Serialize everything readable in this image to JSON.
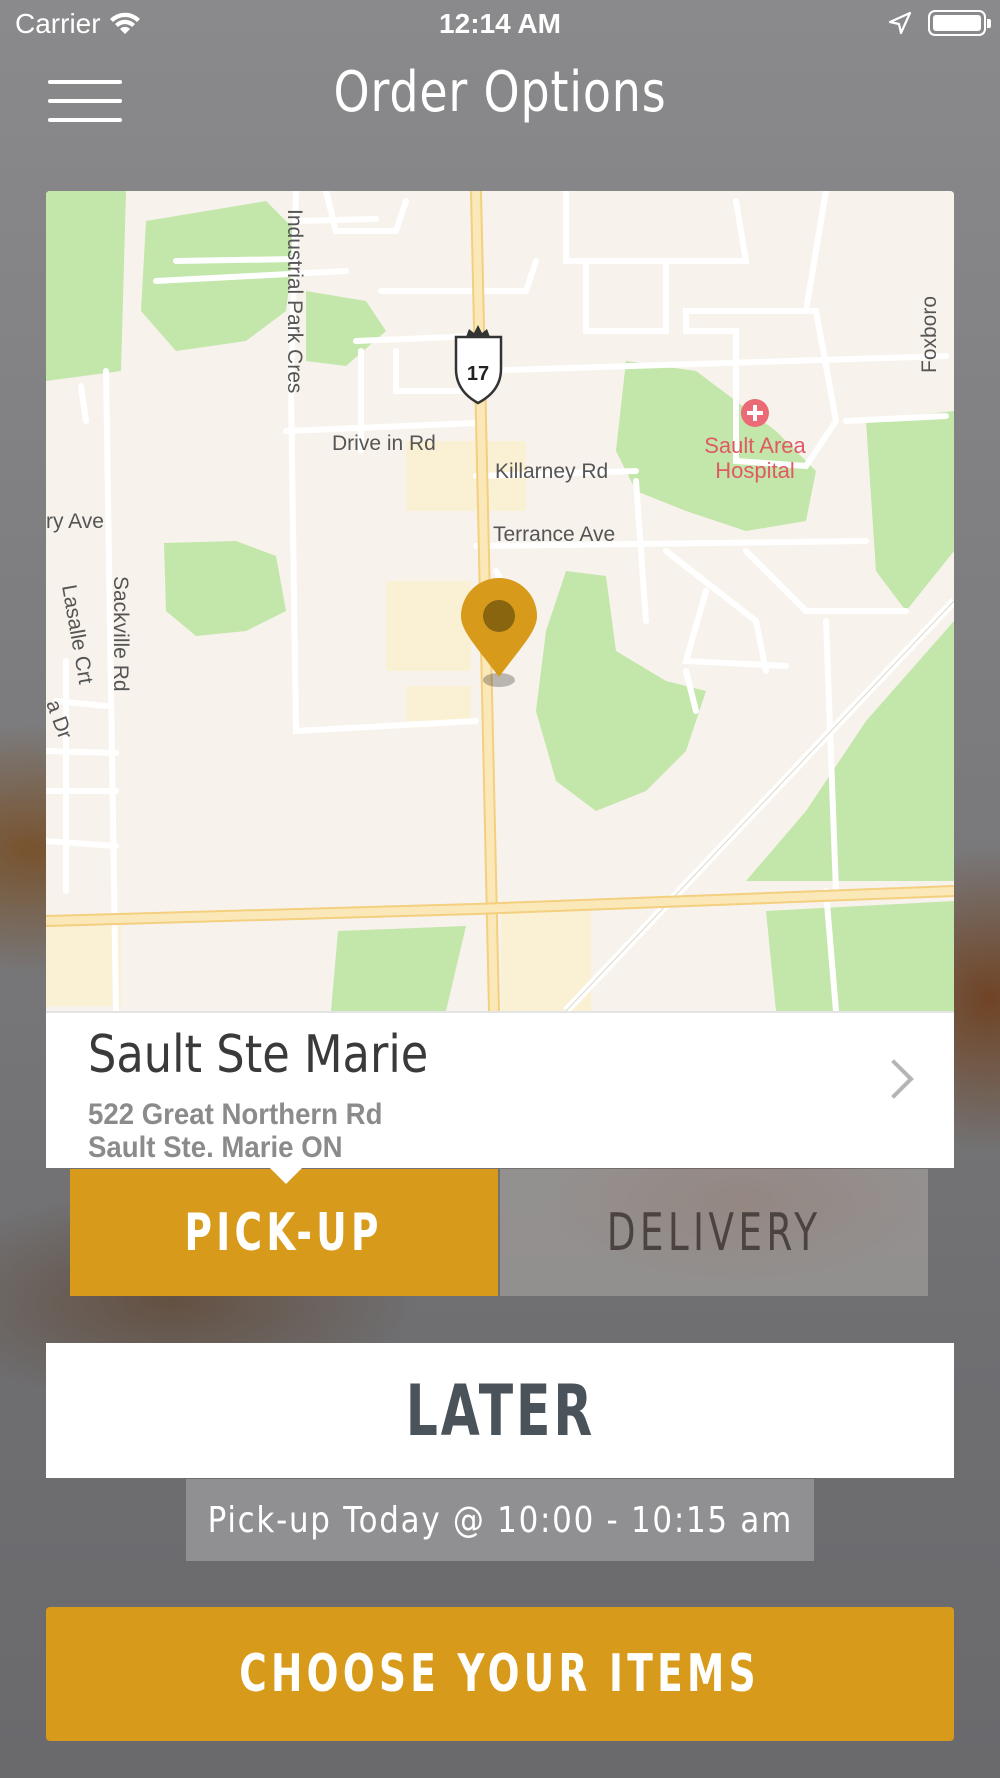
{
  "status_bar": {
    "carrier": "Carrier",
    "time": "12:14 AM"
  },
  "nav": {
    "title": "Order Options"
  },
  "map": {
    "route_shield": "17",
    "streets": {
      "industrial_park": "Industrial Park Cres",
      "drive_in": "Drive in Rd",
      "killarney": "Killarney Rd",
      "terrance": "Terrance Ave",
      "sackville": "Sackville Rd",
      "lasalle": "Lasalle Crt",
      "ry_ave": "ry Ave",
      "a_dr": "a Dr",
      "foxboro": "Foxboro"
    },
    "hospital_line1": "Sault Area",
    "hospital_line2": "Hospital"
  },
  "location": {
    "name": "Sault Ste Marie",
    "address_line1": "522 Great Northern Rd",
    "address_line2": "Sault Ste. Marie ON"
  },
  "order_type": {
    "pickup_label": "PICK-UP",
    "delivery_label": "DELIVERY",
    "selected": "pickup"
  },
  "timing": {
    "later_label": "LATER",
    "time_text": "Pick-up Today @ 10:00 - 10:15 am"
  },
  "cta": {
    "label": "CHOOSE YOUR ITEMS"
  },
  "colors": {
    "accent": "#d89a1a",
    "map_bg": "#f7f3ec",
    "map_park": "#c3e6aa",
    "map_road": "#fbe3a6"
  }
}
